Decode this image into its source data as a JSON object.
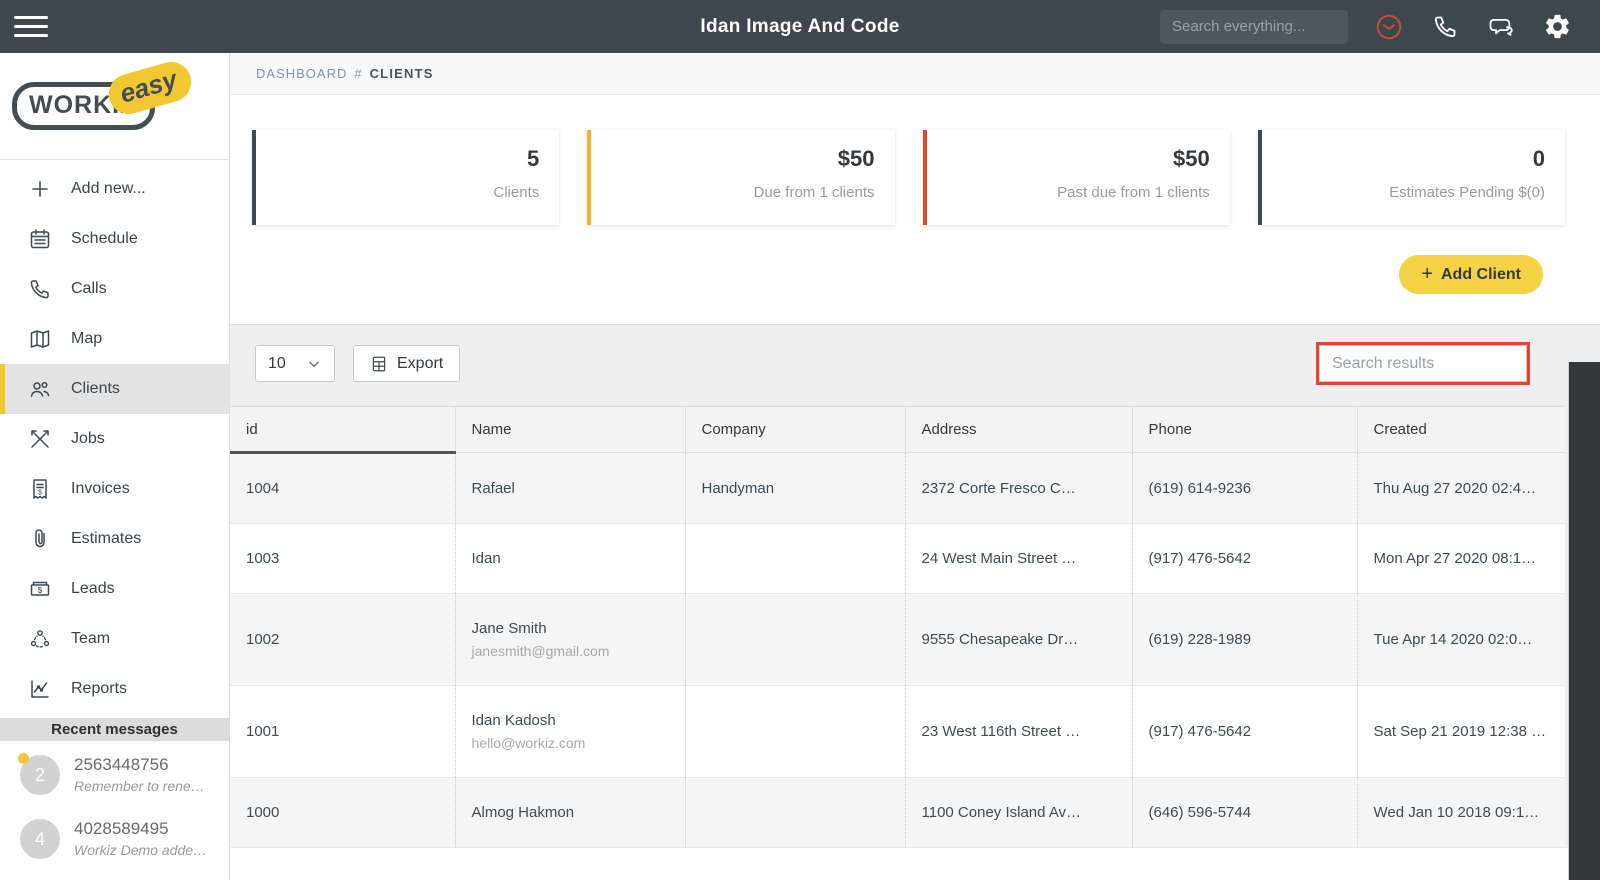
{
  "topbar": {
    "title": "Idan Image And Code",
    "search_placeholder": "Search everything...",
    "icon_names": [
      "hamburger-icon",
      "clock-icon",
      "phone-icon",
      "chat-icon",
      "gear-icon"
    ],
    "clock_icon_color": "#c94f2e",
    "bar_color": "#3d484e"
  },
  "sidebar": {
    "logo": {
      "primary": "WORKIZ",
      "accent": "easy",
      "accent_color": "#f2c832"
    },
    "items": [
      {
        "label": "Add new...",
        "icon": "plus-icon"
      },
      {
        "label": "Schedule",
        "icon": "calendar-icon"
      },
      {
        "label": "Calls",
        "icon": "phone-icon"
      },
      {
        "label": "Map",
        "icon": "map-icon"
      },
      {
        "label": "Clients",
        "icon": "clients-icon",
        "active": true
      },
      {
        "label": "Jobs",
        "icon": "tools-icon"
      },
      {
        "label": "Invoices",
        "icon": "invoice-icon"
      },
      {
        "label": "Estimates",
        "icon": "paperclip-icon"
      },
      {
        "label": "Leads",
        "icon": "money-icon"
      },
      {
        "label": "Team",
        "icon": "team-icon"
      },
      {
        "label": "Reports",
        "icon": "chart-icon"
      }
    ],
    "active_accent_color": "#f0cb30",
    "recent_messages": {
      "header": "Recent messages",
      "items": [
        {
          "avatar": "2",
          "title": "2563448756",
          "subtitle": "Remember to rene…",
          "unread": true
        },
        {
          "avatar": "4",
          "title": "4028589495",
          "subtitle": "Workiz Demo adde…",
          "unread": false
        }
      ]
    }
  },
  "breadcrumb": {
    "parent": "DASHBOARD",
    "separator": "#",
    "current": "CLIENTS"
  },
  "stats": {
    "cards": [
      {
        "value": "5",
        "label": "Clients",
        "accent": "#3e4950"
      },
      {
        "value": "$50",
        "label": "Due from 1 clients",
        "accent": "#f0b32f"
      },
      {
        "value": "$50",
        "label": "Past due from 1 clients",
        "accent": "#dd4a2a"
      },
      {
        "value": "0",
        "label": "Estimates Pending $(0)",
        "accent": "#3e4950"
      }
    ]
  },
  "actions": {
    "add_client_label": "Add Client",
    "add_client_plus": "+",
    "add_client_color": "#f4d243",
    "page_size_value": "10",
    "export_label": "Export",
    "search_results_placeholder": "Search results",
    "search_highlight_color": "#e8432c"
  },
  "table": {
    "columns": [
      "id",
      "Name",
      "Company",
      "Address",
      "Phone",
      "Created"
    ],
    "sorted_column": "id",
    "rows": [
      {
        "id": "1004",
        "name": "Rafael",
        "email": "",
        "company": "Handyman",
        "address": "2372 Corte Fresco C…",
        "phone": "(619) 614-9236",
        "created": "Thu Aug 27 2020 02:4…"
      },
      {
        "id": "1003",
        "name": "Idan",
        "email": "",
        "company": "",
        "address": "24 West Main Street …",
        "phone": "(917) 476-5642",
        "created": "Mon Apr 27 2020 08:1…"
      },
      {
        "id": "1002",
        "name": "Jane Smith",
        "email": "janesmith@gmail.com",
        "company": "",
        "address": "9555 Chesapeake Dr…",
        "phone": "(619) 228-1989",
        "created": "Tue Apr 14 2020 02:0…"
      },
      {
        "id": "1001",
        "name": "Idan Kadosh",
        "email": "hello@workiz.com",
        "company": "",
        "address": "23 West 116th Street …",
        "phone": "(917) 476-5642",
        "created": "Sat Sep 21 2019 12:38 …"
      },
      {
        "id": "1000",
        "name": "Almog Hakmon",
        "email": "",
        "company": "",
        "address": "1100 Coney Island Av…",
        "phone": "(646) 596-5744",
        "created": "Wed Jan 10 2018 09:1…"
      }
    ]
  }
}
